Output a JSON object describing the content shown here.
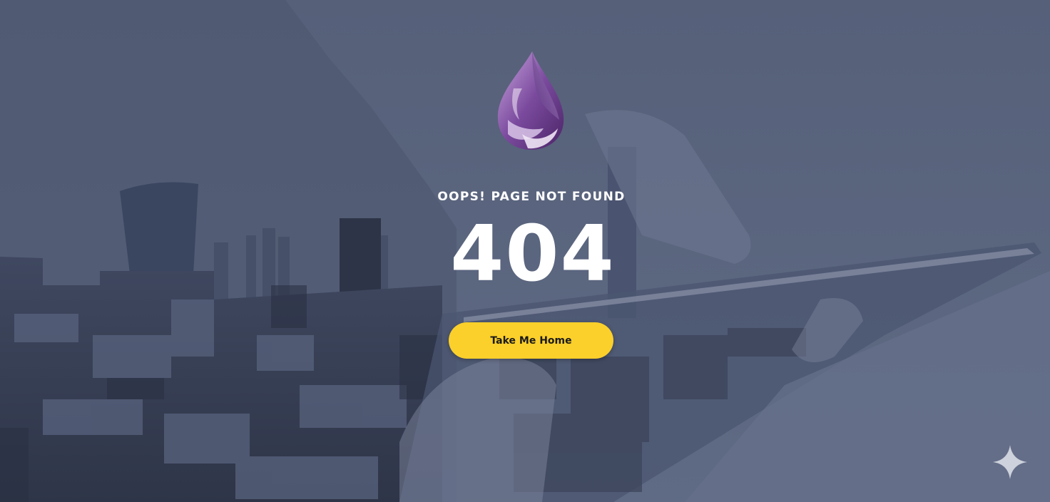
{
  "page": {
    "subtitle": "OOPS! PAGE NOT FOUND",
    "error_code": "404",
    "home_button_label": "Take Me Home"
  },
  "icons": {
    "logo": "purple-drop-logo-icon",
    "corner": "sparkle-icon"
  },
  "colors": {
    "overlay": "#5b6680",
    "button": "#fcd02a",
    "button_text": "#1a1a1a",
    "text": "#ffffff",
    "logo_primary": "#7b4a9e"
  }
}
